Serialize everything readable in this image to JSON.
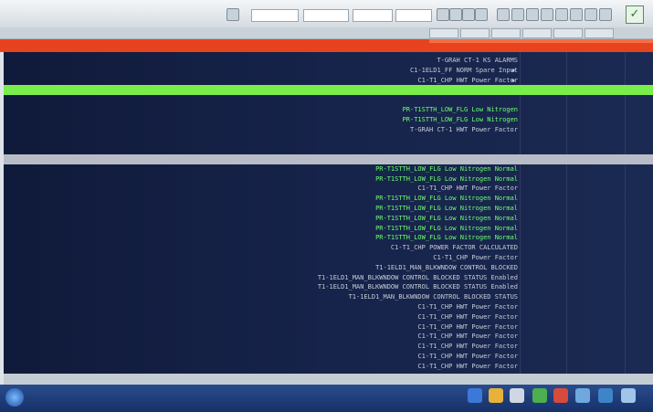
{
  "app": {
    "title": ""
  },
  "toolbar": {
    "ok_label": "✓"
  },
  "rows": [
    {
      "desc": "T-GRAH CT-1 KS ALARMS",
      "flag": "",
      "date": "",
      "time": "",
      "chan": ""
    },
    {
      "desc": "C1-1ELD1_FF NORM Spare Input",
      "flag": "▪",
      "date": "",
      "time": "",
      "chan": ""
    },
    {
      "desc": "C1-T1_CHP HWT Power Factor",
      "flag": "▪",
      "date": "",
      "time": "",
      "chan": ""
    },
    {
      "desc": "",
      "flag": "",
      "date": "",
      "time": "",
      "chan": ""
    },
    {
      "desc": "",
      "flag": "",
      "date": "",
      "time": "",
      "chan": ""
    },
    {
      "desc": "PR-T1STTH_LOW_FLG Low Nitrogen",
      "flag": "",
      "date": "",
      "time": "",
      "chan": ""
    },
    {
      "desc": "PR-T1STTH_LOW_FLG Low Nitrogen",
      "flag": "",
      "date": "",
      "time": "",
      "chan": ""
    },
    {
      "desc": "T-GRAH CT-1 HWT Power Factor",
      "flag": "",
      "date": "",
      "time": "",
      "chan": ""
    },
    {
      "desc": "",
      "flag": "",
      "date": "",
      "time": "",
      "chan": ""
    },
    {
      "desc": "",
      "flag": "",
      "date": "",
      "time": "",
      "chan": ""
    },
    {
      "desc": "",
      "flag": "",
      "date": "",
      "time": "",
      "chan": ""
    },
    {
      "desc": "PR-T1STTH_LOW_FLG Low Nitrogen Normal",
      "flag": "",
      "date": "",
      "time": "",
      "chan": ""
    },
    {
      "desc": "PR-T1STTH_LOW_FLG Low Nitrogen Normal",
      "flag": "",
      "date": "",
      "time": "",
      "chan": ""
    },
    {
      "desc": "C1-T1_CHP HWT Power Factor",
      "flag": "",
      "date": "",
      "time": "",
      "chan": ""
    },
    {
      "desc": "PR-T1STTH_LOW_FLG Low Nitrogen Normal",
      "flag": "",
      "date": "",
      "time": "",
      "chan": ""
    },
    {
      "desc": "PR-T1STTH_LOW_FLG Low Nitrogen Normal",
      "flag": "",
      "date": "",
      "time": "",
      "chan": ""
    },
    {
      "desc": "PR-T1STTH_LOW_FLG Low Nitrogen Normal",
      "flag": "",
      "date": "",
      "time": "",
      "chan": ""
    },
    {
      "desc": "PR-T1STTH_LOW_FLG Low Nitrogen Normal",
      "flag": "",
      "date": "",
      "time": "",
      "chan": ""
    },
    {
      "desc": "PR-T1STTH_LOW_FLG Low Nitrogen Normal",
      "flag": "",
      "date": "",
      "time": "",
      "chan": ""
    },
    {
      "desc": "C1-T1_CHP POWER FACTOR CALCULATED",
      "flag": "",
      "date": "",
      "time": "",
      "chan": ""
    },
    {
      "desc": "C1-T1_CHP Power Factor",
      "flag": "",
      "date": "",
      "time": "",
      "chan": ""
    },
    {
      "desc": "T1-1ELD1_MAN_BLKWNDOW CONTROL BLOCKED",
      "flag": "",
      "date": "",
      "time": "",
      "chan": ""
    },
    {
      "desc": "T1-1ELD1_MAN_BLKWNDOW CONTROL BLOCKED STATUS Enabled",
      "flag": "",
      "date": "",
      "time": "",
      "chan": ""
    },
    {
      "desc": "T1-1ELD1_MAN_BLKWNDOW CONTROL BLOCKED STATUS Enabled",
      "flag": "",
      "date": "",
      "time": "",
      "chan": ""
    },
    {
      "desc": "T1-1ELD1_MAN_BLKWNDOW CONTROL BLOCKED STATUS",
      "flag": "",
      "date": "",
      "time": "",
      "chan": ""
    },
    {
      "desc": "C1-T1_CHP HWT Power Factor",
      "flag": "",
      "date": "",
      "time": "",
      "chan": ""
    },
    {
      "desc": "C1-T1_CHP HWT Power Factor",
      "flag": "",
      "date": "",
      "time": "",
      "chan": ""
    },
    {
      "desc": "C1-T1_CHP HWT Power Factor",
      "flag": "",
      "date": "",
      "time": "",
      "chan": ""
    },
    {
      "desc": "C1-T1_CHP HWT Power Factor",
      "flag": "",
      "date": "",
      "time": "",
      "chan": ""
    },
    {
      "desc": "C1-T1_CHP HWT Power Factor",
      "flag": "",
      "date": "",
      "time": "",
      "chan": ""
    },
    {
      "desc": "C1-T1_CHP HWT Power Factor",
      "flag": "",
      "date": "",
      "time": "",
      "chan": ""
    },
    {
      "desc": "C1-T1_CHP HWT Power Factor",
      "flag": "",
      "date": "",
      "time": "",
      "chan": ""
    }
  ],
  "colors": {
    "alarm_bar": "#e8431f",
    "selected_green": "#79ee4a",
    "selected_grey": "#b7bcc6",
    "list_bg": "#101a3a",
    "green_text": "#6dff6d"
  }
}
